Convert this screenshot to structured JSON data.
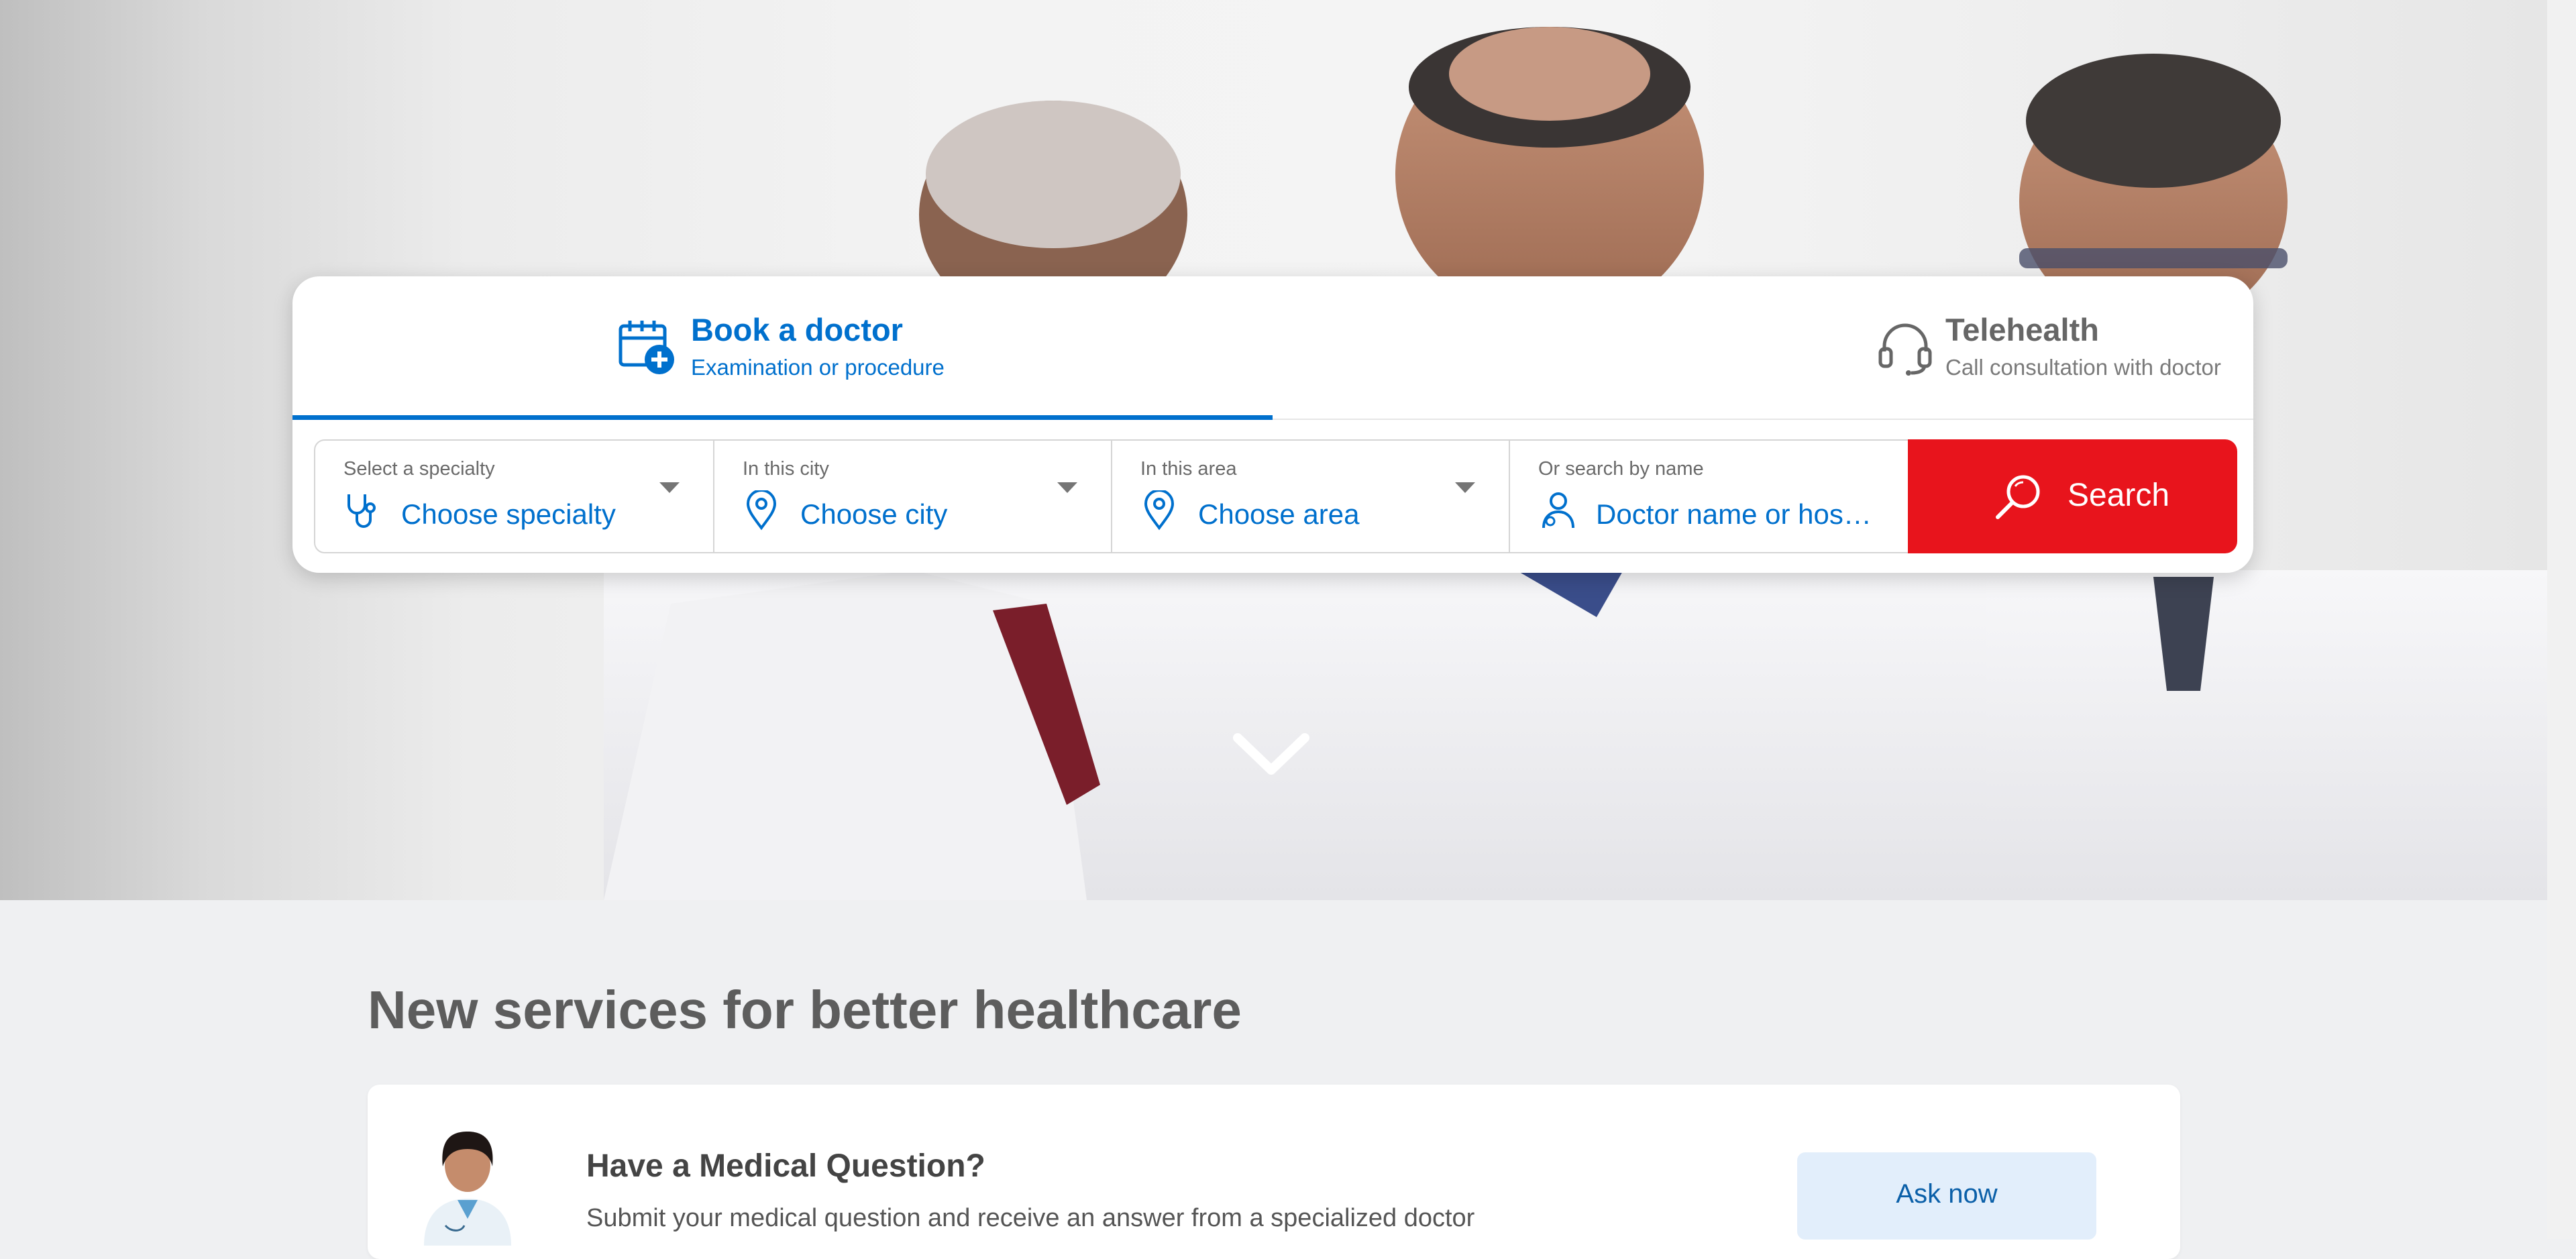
{
  "hero": {
    "image_alt": "three doctors in white coats"
  },
  "booking": {
    "tabs": [
      {
        "title": "Book a doctor",
        "subtitle": "Examination or procedure",
        "icon": "calendar-plus-icon",
        "active": true
      },
      {
        "title": "Telehealth",
        "subtitle": "Call consultation with doctor",
        "icon": "headset-icon",
        "active": false
      }
    ],
    "fields": [
      {
        "label": "Select a specialty",
        "value": "Choose specialty",
        "icon": "stethoscope-icon"
      },
      {
        "label": "In this city",
        "value": "Choose city",
        "icon": "location-pin-icon"
      },
      {
        "label": "In this area",
        "value": "Choose area",
        "icon": "location-pin-icon"
      },
      {
        "label": "Or search by name",
        "placeholder": "Doctor name or hospital",
        "icon": "doctor-icon"
      }
    ],
    "search_label": "Search",
    "colors": {
      "accent": "#0070cd",
      "search": "#e8141c"
    }
  },
  "services": {
    "title": "New services for better healthcare",
    "card": {
      "heading": "Have a Medical Question?",
      "description": "Submit your medical question and receive an answer from a specialized doctor",
      "button_label": "Ask now"
    }
  }
}
